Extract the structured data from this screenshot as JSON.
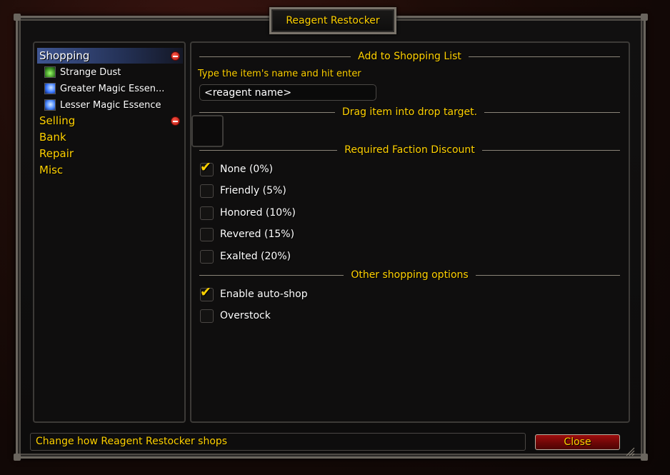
{
  "window": {
    "title": "Reagent Restocker"
  },
  "sidebar": {
    "categories": [
      {
        "label": "Shopping",
        "selected": true,
        "expanded": true
      },
      {
        "label": "Selling",
        "expanded": true
      },
      {
        "label": "Bank"
      },
      {
        "label": "Repair"
      },
      {
        "label": "Misc"
      }
    ],
    "shopping_items": [
      {
        "label": "Strange Dust",
        "icon": "strange-dust-icon"
      },
      {
        "label": "Greater Magic Essen...",
        "icon": "greater-magic-essence-icon"
      },
      {
        "label": "Lesser Magic Essence",
        "icon": "lesser-magic-essence-icon"
      }
    ]
  },
  "main": {
    "add_section": {
      "header": "Add to Shopping List",
      "hint": "Type the item's name and hit enter",
      "input_value": "<reagent name>"
    },
    "drag_section": {
      "header": "Drag item into drop target."
    },
    "faction_section": {
      "header": "Required Faction Discount",
      "options": [
        {
          "label": "None (0%)",
          "checked": true
        },
        {
          "label": "Friendly (5%)",
          "checked": false
        },
        {
          "label": "Honored (10%)",
          "checked": false
        },
        {
          "label": "Revered (15%)",
          "checked": false
        },
        {
          "label": "Exalted (20%)",
          "checked": false
        }
      ]
    },
    "other_section": {
      "header": "Other shopping options",
      "options": [
        {
          "label": "Enable auto-shop",
          "checked": true
        },
        {
          "label": "Overstock",
          "checked": false
        }
      ]
    }
  },
  "footer": {
    "status_text": "Change how Reagent Restocker shops",
    "close_label": "Close"
  },
  "glyphs": {
    "check": "✔"
  },
  "colors": {
    "accent_gold": "#ffd100",
    "selection_blue": "#506ebe",
    "close_red": "#9e0d0d"
  }
}
